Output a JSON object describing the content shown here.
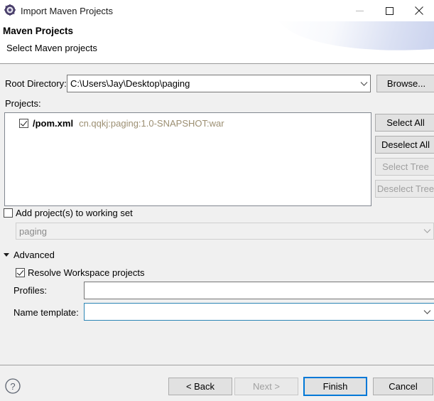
{
  "window": {
    "title": "Import Maven Projects",
    "icon": "maven-gear-icon",
    "controls": {
      "minimize": "minimize-icon",
      "maximize": "maximize-icon",
      "close": "close-icon"
    }
  },
  "header": {
    "title": "Maven Projects",
    "subtitle": "Select Maven projects"
  },
  "root_directory": {
    "label": "Root Directory:",
    "value": "C:\\Users\\Jay\\Desktop\\paging",
    "browse_label": "Browse..."
  },
  "projects": {
    "label": "Projects:",
    "rows": [
      {
        "checked": true,
        "name": "/pom.xml",
        "coordinates": "cn.qqkj:paging:1.0-SNAPSHOT:war"
      }
    ],
    "buttons": [
      {
        "label": "Select All",
        "enabled": true
      },
      {
        "label": "Deselect All",
        "enabled": true
      },
      {
        "label": "Select Tree",
        "enabled": false
      },
      {
        "label": "Deselect Tree",
        "enabled": false
      }
    ]
  },
  "working_set": {
    "checkbox_label": "Add project(s) to working set",
    "checked": false,
    "value": "paging",
    "enabled": false
  },
  "advanced": {
    "label": "Advanced",
    "expanded": true,
    "resolve_label": "Resolve Workspace projects",
    "resolve_checked": true,
    "profiles_label": "Profiles:",
    "profiles_value": "",
    "name_template_label": "Name template:",
    "name_template_value": ""
  },
  "footer": {
    "help": "help-icon",
    "buttons": [
      {
        "label": "< Back",
        "enabled": true,
        "default": false
      },
      {
        "label": "Next >",
        "enabled": false,
        "default": false
      },
      {
        "label": "Finish",
        "enabled": true,
        "default": true
      },
      {
        "label": "Cancel",
        "enabled": true,
        "default": false
      }
    ]
  },
  "colors": {
    "accent": "#0078d7",
    "coordinate_text": "#9c8f72",
    "dialog_bg": "#f0f0f0",
    "focus_border": "#2d86b5"
  }
}
